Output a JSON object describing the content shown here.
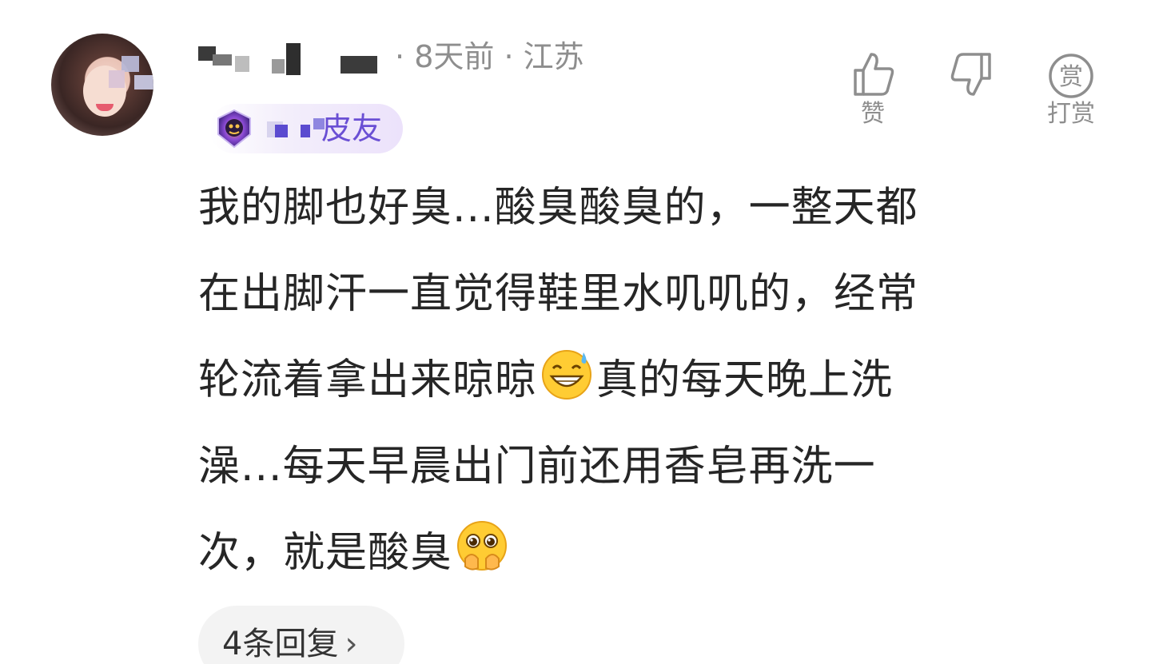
{
  "comment": {
    "time_ago": "8天前",
    "location": "江苏",
    "separator": "·",
    "badge_label": "皮友",
    "content_lines": [
      "我的脚也好臭...酸臭酸臭的，一整天都",
      "在出脚汗一直觉得鞋里水叽叽的，经常",
      "轮流着拿出来晾晾",
      "真的每天晚上洗",
      "澡...每天早晨出门前还用香皂再洗一",
      "次，就是酸臭"
    ],
    "emojis": [
      "grinning-sweat-emoji",
      "pleading-hands-emoji"
    ]
  },
  "actions": {
    "like_label": "赞",
    "dislike_label": "",
    "reward_label": "打赏",
    "reward_icon_char": "赏"
  },
  "replies": {
    "label": "4条回复",
    "chevron": "›"
  },
  "colors": {
    "text": "#262626",
    "meta": "#8e8e8e",
    "badge_text": "#6a4fd4",
    "replies_bg": "#f3f3f3"
  }
}
